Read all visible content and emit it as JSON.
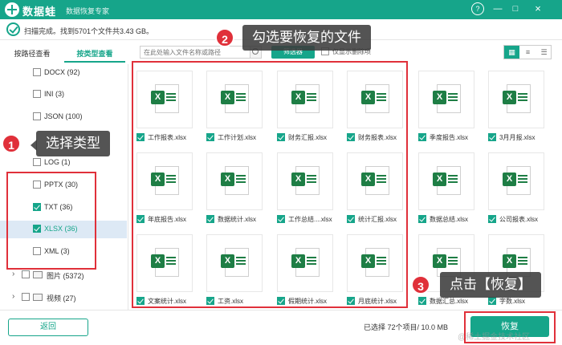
{
  "titlebar": {
    "app_name": "数据蛙",
    "subtitle": "数据恢复专家",
    "help": "?",
    "minimize": "—",
    "maximize": "□",
    "close": "×"
  },
  "status": {
    "scan_text": "扫描完成。找到5701个文件共3.43 GB。"
  },
  "tabs": [
    {
      "label": "按路径查看",
      "active": false
    },
    {
      "label": "按类型查看",
      "active": true
    }
  ],
  "tree": {
    "items": [
      {
        "label": "DOCX (92)",
        "checked": false
      },
      {
        "label": "INI (3)",
        "checked": false
      },
      {
        "label": "JSON (100)",
        "checked": false
      },
      {
        "label": "LOG (1)",
        "checked": false
      },
      {
        "label": "PPTX (30)",
        "checked": false
      },
      {
        "label": "TXT (36)",
        "checked": true
      },
      {
        "label": "XLSX (36)",
        "checked": true,
        "selected": true
      },
      {
        "label": "XML (3)",
        "checked": false
      }
    ],
    "folders": [
      {
        "label": "图片 (5372)",
        "expander": "›"
      },
      {
        "label": "视频 (27)",
        "expander": "›"
      }
    ]
  },
  "toolbar": {
    "search_placeholder": "在此处输入文件名称或路径",
    "filter_label": "筛选器",
    "only_deleted_label": "仅显示删除项",
    "view_icons": [
      "▦",
      "≡",
      "☰"
    ]
  },
  "files": [
    {
      "name": "工作报表.xlsx"
    },
    {
      "name": "工作计划.xlsx"
    },
    {
      "name": "财务汇报.xlsx"
    },
    {
      "name": "财务报表.xlsx"
    },
    {
      "name": "季度报告.xlsx"
    },
    {
      "name": "3月月报.xlsx"
    },
    {
      "name": "年底报告.xlsx"
    },
    {
      "name": "数据统计.xlsx"
    },
    {
      "name": "工作总结....xlsx"
    },
    {
      "name": "统计汇报.xlsx"
    },
    {
      "name": "数据总结.xlsx"
    },
    {
      "name": "公司报表.xlsx"
    },
    {
      "name": "文案统计.xlsx"
    },
    {
      "name": "工资.xlsx"
    },
    {
      "name": "假期统计.xlsx"
    },
    {
      "name": "月底统计.xlsx"
    },
    {
      "name": "数据汇总.xlsx"
    },
    {
      "name": "字数.xlsx"
    }
  ],
  "footer": {
    "back_label": "返回",
    "selected_info": "已选择 72个项目/ 10.0 MB",
    "recover_label": "恢复",
    "watermark": "@稀土掘金技术社区"
  },
  "callouts": [
    {
      "number": "1",
      "text": "选择类型"
    },
    {
      "number": "2",
      "text": "勾选要恢复的文件"
    },
    {
      "number": "3",
      "text": "点击【恢复】"
    }
  ],
  "colors": {
    "brand": "#16a58a",
    "excel": "#1e7e45",
    "annotation": "#e0303a"
  }
}
